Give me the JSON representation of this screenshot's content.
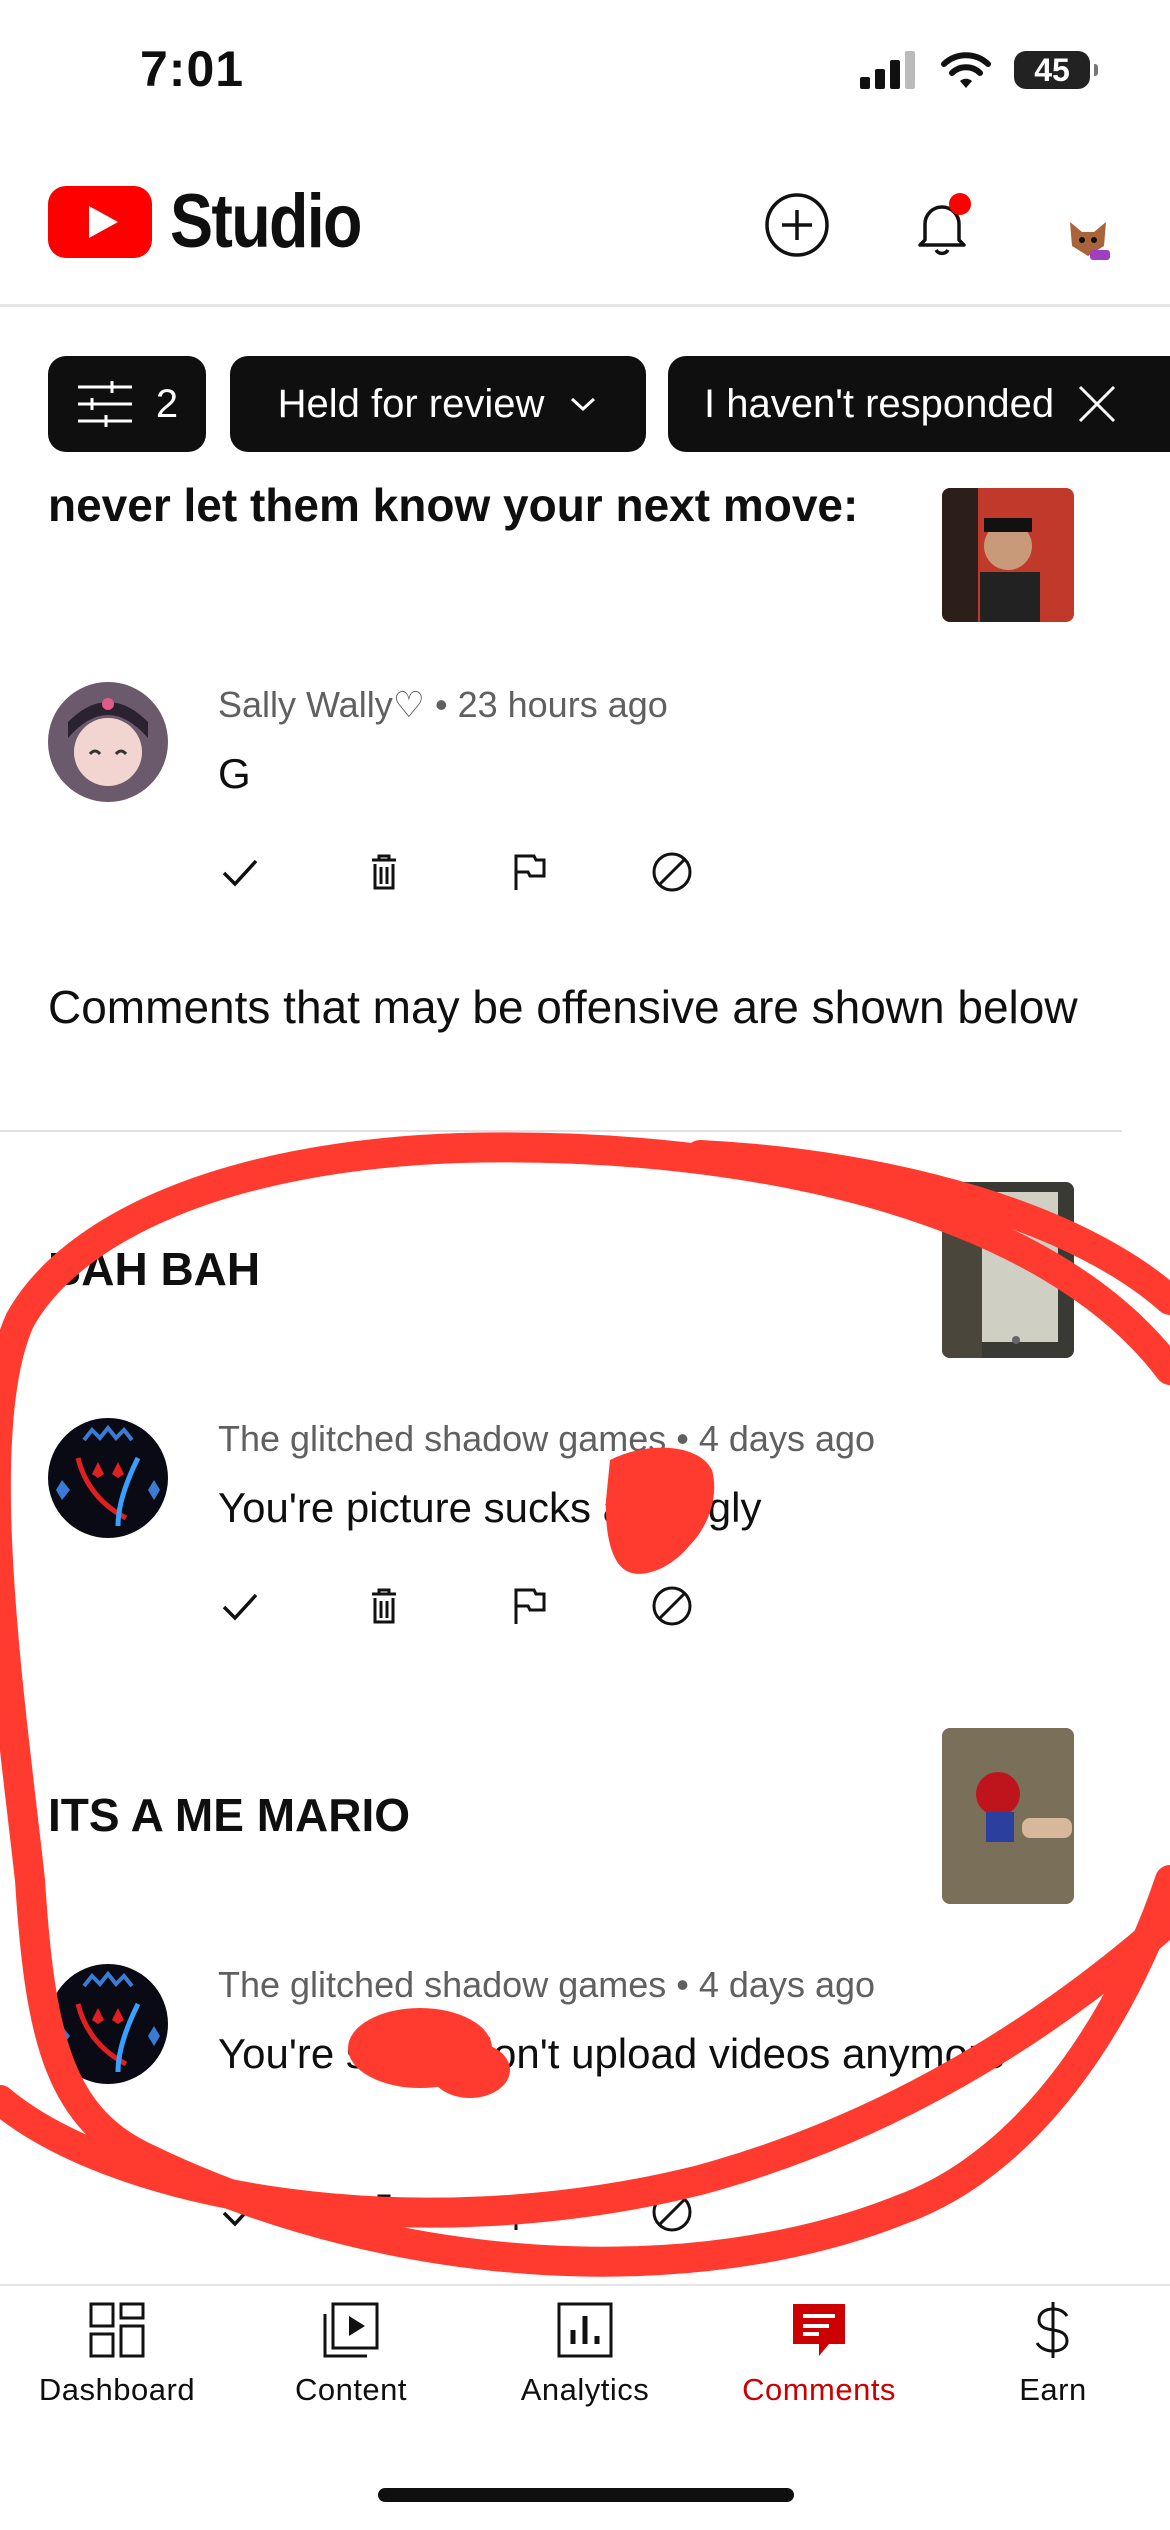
{
  "status_bar": {
    "time": "7:01",
    "battery": "45"
  },
  "header": {
    "app_name": "Studio"
  },
  "filters": {
    "count": "2",
    "held_label": "Held for review",
    "responded_label": "I haven't responded"
  },
  "comments_top": [
    {
      "video_title": "never let them know your next move:",
      "author": "Sally Wally♡",
      "time": "• 23 hours ago",
      "text": "G"
    }
  ],
  "offensive_notice": "Comments that may be offensive are shown below",
  "comments_offensive": [
    {
      "video_title": "BAH BAH",
      "author": "The glitched shadow games",
      "time": "• 4 days ago",
      "text": "You're picture sucks and ugly"
    },
    {
      "video_title": "ITS A ME MARIO",
      "author": "The glitched shadow games",
      "time": "• 4 days ago",
      "text": "You're stupid don't upload videos anymore"
    }
  ],
  "bottom_nav": [
    {
      "label": "Dashboard",
      "icon": "dashboard-icon"
    },
    {
      "label": "Content",
      "icon": "content-icon"
    },
    {
      "label": "Analytics",
      "icon": "analytics-icon"
    },
    {
      "label": "Comments",
      "icon": "comments-icon",
      "active": true
    },
    {
      "label": "Earn",
      "icon": "dollar-icon"
    }
  ],
  "colors": {
    "brand_red": "#ff0000",
    "active_red": "#cc0000",
    "scribble_red": "#ff3b2f"
  }
}
